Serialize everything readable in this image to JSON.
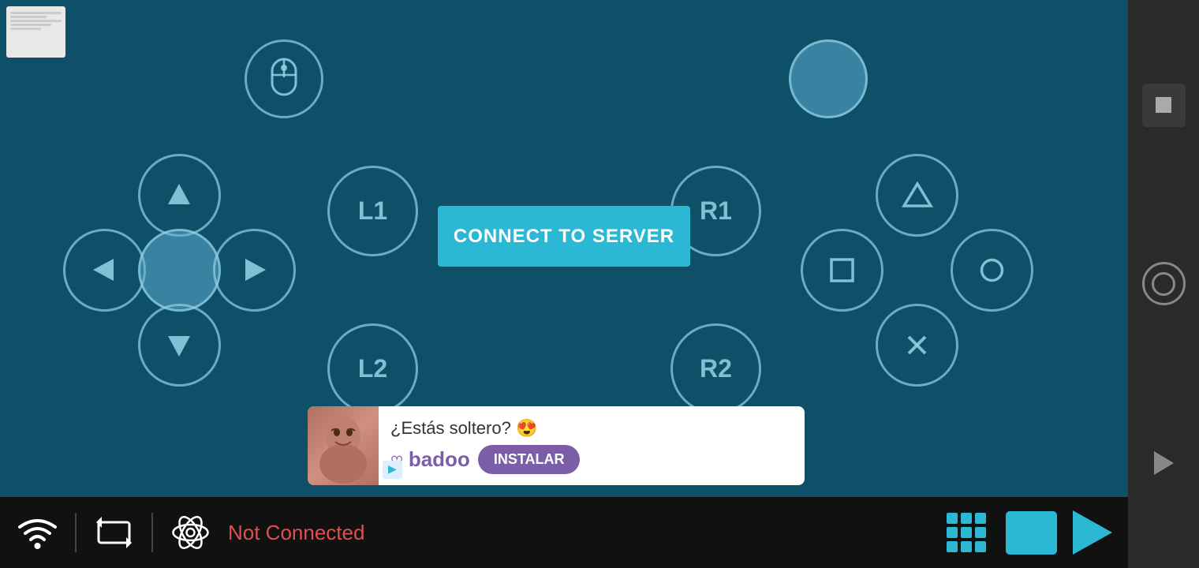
{
  "controller": {
    "connect_btn_label": "CONNECT TO SERVER",
    "l1_label": "L1",
    "r1_label": "R1",
    "l2_label": "L2",
    "r2_label": "R2"
  },
  "ad": {
    "text": "¿Estás soltero? 😍",
    "brand": "♡ badoo",
    "install_label": "INSTALAR"
  },
  "statusbar": {
    "not_connected": "Not Connected"
  },
  "colors": {
    "bg": "#0d5068",
    "accent": "#2ab8d4",
    "btn_stroke": "rgba(150,210,230,0.7)",
    "status_bar": "#111111"
  }
}
